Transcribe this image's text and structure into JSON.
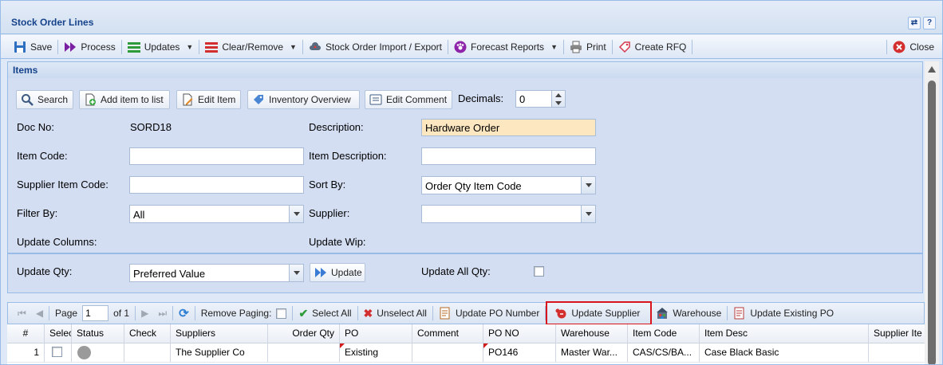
{
  "window": {
    "title": "Stock Order Lines"
  },
  "toolbar": {
    "save": "Save",
    "process": "Process",
    "updates": "Updates",
    "clear_remove": "Clear/Remove",
    "import_export": "Stock Order Import / Export",
    "forecast": "Forecast Reports",
    "print": "Print",
    "create_rfq": "Create RFQ",
    "close": "Close"
  },
  "panel": {
    "title": "Items"
  },
  "actions": {
    "search": "Search",
    "add_item": "Add item to list",
    "edit_item": "Edit Item",
    "inventory_overview": "Inventory Overview",
    "edit_comment": "Edit Comment",
    "update": "Update"
  },
  "form": {
    "decimals_label": "Decimals:",
    "decimals_value": "0",
    "doc_no_label": "Doc No:",
    "doc_no_value": "SORD18",
    "description_label": "Description:",
    "description_value": "Hardware Order",
    "item_code_label": "Item Code:",
    "item_code_value": "",
    "item_description_label": "Item Description:",
    "item_description_value": "",
    "supplier_item_code_label": "Supplier Item Code:",
    "supplier_item_code_value": "",
    "sort_by_label": "Sort By:",
    "sort_by_value": "Order Qty Item Code",
    "filter_by_label": "Filter By:",
    "filter_by_value": "All",
    "supplier_label": "Supplier:",
    "supplier_value": "",
    "update_columns_label": "Update Columns:",
    "update_wip_label": "Update Wip:",
    "update_qty_label": "Update Qty:",
    "update_qty_value": "Preferred Value",
    "update_all_qty_label": "Update All Qty:"
  },
  "pager": {
    "page_label": "Page",
    "page_value": "1",
    "of_label": "of 1",
    "remove_paging": "Remove Paging:",
    "select_all": "Select All",
    "unselect_all": "Unselect All",
    "update_po_number": "Update PO Number",
    "update_supplier": "Update Supplier",
    "warehouse": "Warehouse",
    "update_existing_po": "Update Existing PO"
  },
  "grid": {
    "columns": [
      "#",
      "Selec",
      "Status",
      "Check",
      "Suppliers",
      "Order Qty",
      "PO",
      "Comment",
      "PO NO",
      "Warehouse",
      "Item Code",
      "Item Desc",
      "Supplier Ite"
    ],
    "rows": [
      {
        "num": "1",
        "status_color": "#9a9a9a",
        "check": "",
        "supplier": "The Supplier Co",
        "order_qty": "",
        "po": "Existing",
        "comment": "",
        "po_no": "PO146",
        "warehouse": "Master War...",
        "item_code": "CAS/CS/BA...",
        "item_desc": "Case Black Basic",
        "supplier_item": ""
      }
    ]
  },
  "colors": {
    "accent": "#15428b",
    "highlight": "#d8141c",
    "field_highlight": "#fde7c0"
  }
}
